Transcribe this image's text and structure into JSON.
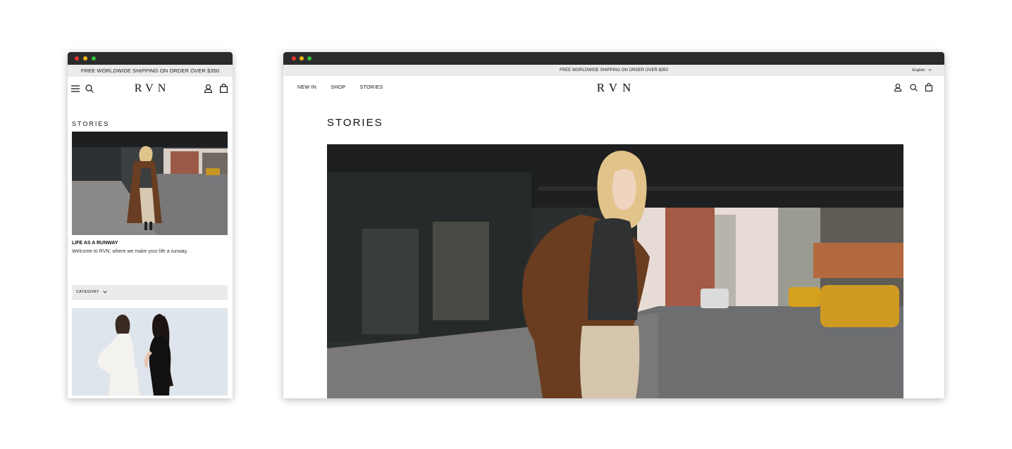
{
  "shipping_banner": "FREE WORLDWIDE SHIPPING ON ORDER OVER $350",
  "brand_logo": "RVN",
  "language": "English",
  "nav": [
    "NEW IN",
    "SHOP",
    "STORIES"
  ],
  "page_title": "STORIES",
  "story": {
    "title": "LIFE AS A RUNWAY",
    "description": "Welcome to RVN, where we make your life a runway."
  },
  "filter": {
    "label": "CATEGORY"
  },
  "icons": {
    "menu": "hamburger-menu-icon",
    "search": "search-icon",
    "account": "user-icon",
    "cart": "shopping-bag-icon",
    "dropdown": "chevron-down-icon"
  },
  "colors": {
    "titlebar": "#2b2b2b",
    "banner": "#ebebeb",
    "window_close": "#e7342b",
    "window_minimize": "#f5b319",
    "window_maximize": "#2fbd3a"
  }
}
